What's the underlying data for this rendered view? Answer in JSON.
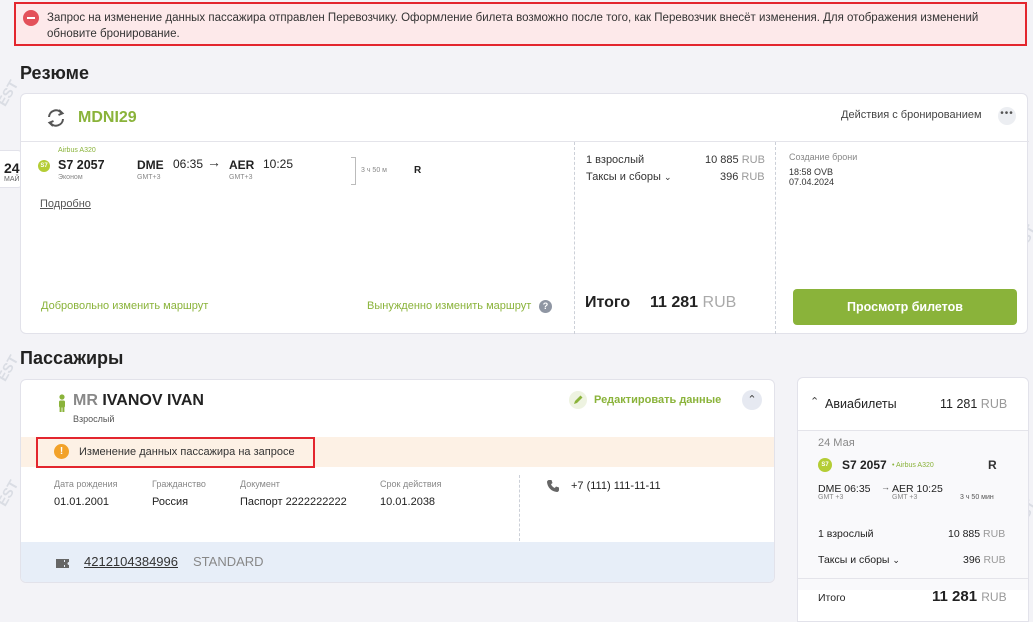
{
  "alert": {
    "text": "Запрос на изменение данных пассажира отправлен Перевозчику. Оформление билета возможно после того, как Перевозчик внесёт изменения. Для отображения изменений обновите бронирование."
  },
  "summary": {
    "title": "Резюме",
    "pnr": "MDNI29",
    "actions_label": "Действия с бронированием",
    "more_label": "•••",
    "date_day": "24",
    "date_month": "МАЙ",
    "flight": {
      "aircraft": "Airbus A320",
      "airline_badge": "S7",
      "number": "S7 2057",
      "class": "Эконом",
      "from_code": "DME",
      "dep_time": "06:35",
      "from_tz": "GMT+3",
      "to_code": "AER",
      "arr_time": "10:25",
      "to_tz": "GMT+3",
      "duration": "3 ч 50 м",
      "fare_class": "R"
    },
    "details_link": "Подробно",
    "voluntary_change": "Добровольно изменить маршрут",
    "forced_change": "Вынужденно изменить маршрут",
    "help_icon": "?",
    "price": {
      "adult_label": "1 взрослый",
      "adult_amount": "10 885",
      "taxes_label": "Таксы и сборы",
      "taxes_amount": "396",
      "currency": "RUB",
      "total_label": "Итого",
      "total_amount": "11 281"
    },
    "booking": {
      "label": "Создание брони",
      "time_office": "18:58 OVB",
      "date": "07.04.2024"
    },
    "view_tickets_button": "Просмотр билетов"
  },
  "passengers": {
    "title": "Пассажиры",
    "title_prefix": "MR",
    "name": "IVANOV IVAN",
    "type": "Взрослый",
    "edit_label": "Редактировать данные",
    "warning_icon": "!",
    "warning_text": "Изменение данных пассажира на запросе",
    "birth_label": "Дата рождения",
    "birth_value": "01.01.2001",
    "citizenship_label": "Гражданство",
    "citizenship_value": "Россия",
    "document_label": "Документ",
    "document_value": "Паспорт 2222222222",
    "validity_label": "Срок действия",
    "validity_value": "10.01.2038",
    "phone": "+7 (111) 111-11-11",
    "ticket_number": "4212104384996",
    "ticket_type": "STANDARD"
  },
  "tickets_panel": {
    "title": "Авиабилеты",
    "total": "11 281",
    "currency": "RUB",
    "date": "24 Мая",
    "airline_badge": "S7",
    "flight_number": "S7 2057",
    "aircraft": "• Airbus A320",
    "fare_class": "R",
    "dep": "DME 06:35",
    "dep_tz": "GMT +3",
    "arr": "AER 10:25",
    "arr_tz": "GMT +3",
    "duration": "3 ч 50 мин",
    "adult_label": "1 взрослый",
    "adult_amount": "10 885",
    "taxes_label": "Таксы и сборы",
    "taxes_amount": "396",
    "total_label": "Итого"
  },
  "colors": {
    "accent_green": "#8ab33a",
    "alert_red": "#e3262e",
    "warning_orange": "#f2a22a"
  }
}
